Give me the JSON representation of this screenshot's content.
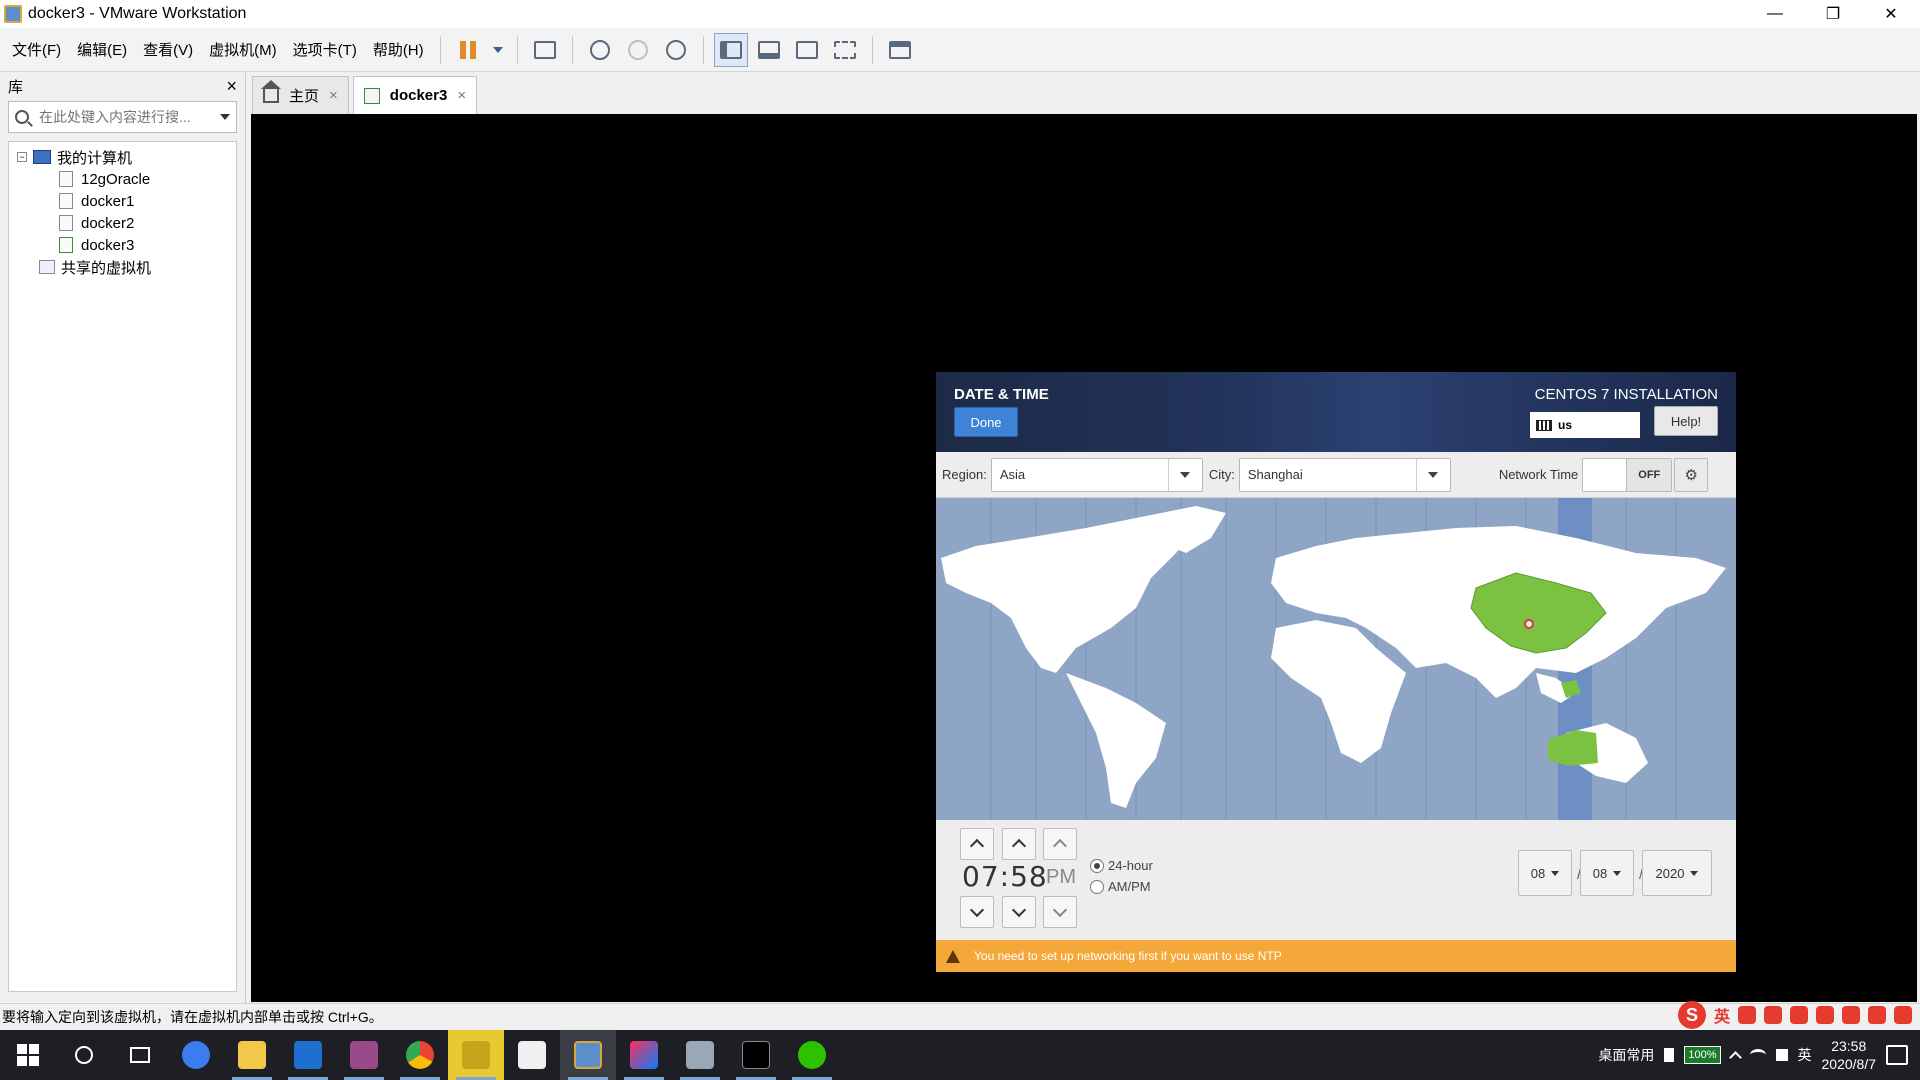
{
  "window": {
    "title": "docker3 - VMware Workstation",
    "controls": [
      "—",
      "❐",
      "✕"
    ]
  },
  "menu": {
    "items": [
      "文件(F)",
      "编辑(E)",
      "查看(V)",
      "虚拟机(M)",
      "选项卡(T)",
      "帮助(H)"
    ]
  },
  "library": {
    "title": "库",
    "close": "×",
    "search_placeholder": "在此处键入内容进行搜...",
    "tree": {
      "root": "我的计算机",
      "root_toggle": "−",
      "vms": [
        "12gOracle",
        "docker1",
        "docker2",
        "docker3"
      ],
      "shared": "共享的虚拟机"
    }
  },
  "tabs": {
    "home": "主页",
    "vm": "docker3",
    "close": "×"
  },
  "installer": {
    "spoke_title": "DATE & TIME",
    "done": "Done",
    "product": "CENTOS 7 INSTALLATION",
    "keyboard": "us",
    "help": "Help!",
    "region_label": "Region:",
    "region_value": "Asia",
    "city_label": "City:",
    "city_value": "Shanghai",
    "network_time_label": "Network Time",
    "network_time_state": "OFF",
    "gear": "⚙",
    "time": "07:58",
    "ampm": "PM",
    "format_24": "24-hour",
    "format_ampm": "AM/PM",
    "format_selected": "24-hour",
    "month": "08",
    "day": "08",
    "year": "2020",
    "date_sep": "/",
    "warning": "You need to set up networking first if you want to use NTP"
  },
  "statusbar": {
    "hint": "要将输入定向到该虚拟机，请在虚拟机内部单击或按 Ctrl+G。",
    "ime_label": "英"
  },
  "taskbar": {
    "tray_label": "桌面常用",
    "battery": "100%",
    "lang": "英",
    "time": "23:58",
    "date": "2020/8/7"
  },
  "colors": {
    "accent_blue": "#3f83d6",
    "warning_orange": "#f5a83a",
    "map_ocean": "#8ea5c6",
    "map_selected": "#7cc242"
  }
}
